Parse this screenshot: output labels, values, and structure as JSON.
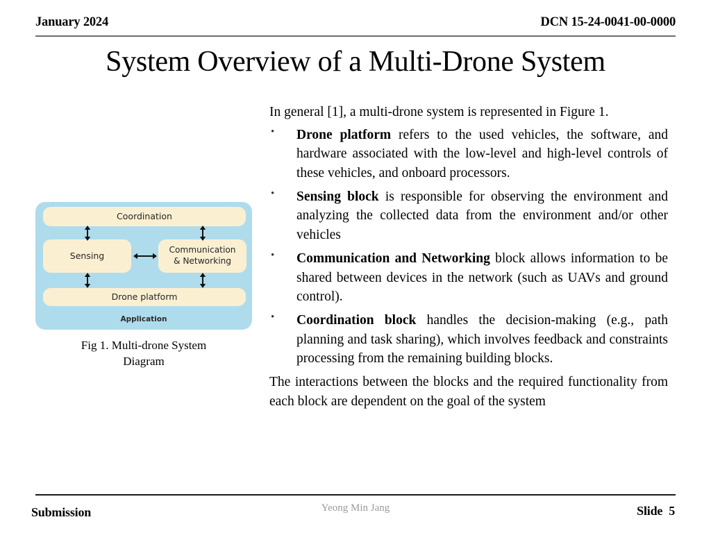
{
  "header": {
    "date": "January 2024",
    "dcn": "DCN 15-24-0041-00-0000"
  },
  "title": "System Overview of a Multi-Drone System",
  "figure": {
    "caption_line1": "Fig 1. Multi-drone System",
    "caption_line2": "Diagram",
    "container_label": "Application",
    "container_color": "#aedcec",
    "block_color": "#fbefd2",
    "blocks": [
      {
        "id": "coordination",
        "label": "Coordination"
      },
      {
        "id": "sensing",
        "label": "Sensing"
      },
      {
        "id": "communication",
        "label_line1": "Communication",
        "label_line2": "& Networking"
      },
      {
        "id": "drone-platform",
        "label": "Drone platform"
      }
    ],
    "arrows": [
      {
        "id": "coordination-sensing",
        "direction": "bidirectional"
      },
      {
        "id": "coordination-communication",
        "direction": "bidirectional"
      },
      {
        "id": "sensing-communication",
        "direction": "bidirectional"
      },
      {
        "id": "sensing-drone-platform",
        "direction": "bidirectional"
      },
      {
        "id": "communication-drone-platform",
        "direction": "bidirectional"
      }
    ]
  },
  "body": {
    "intro": "In general [1], a multi-drone system is represented in Figure 1.",
    "bullets": [
      {
        "term": "Drone platform",
        "text": " refers to the used vehicles, the software, and hardware associated with the low-level and high-level controls of these vehicles, and onboard processors."
      },
      {
        "term": "Sensing block",
        "text": " is responsible for observing the environment and analyzing the collected data from the environment and/or other vehicles"
      },
      {
        "term": "Communication and Networking",
        "text": " block allows information to be shared between devices in the network (such as UAVs and ground control)."
      },
      {
        "term": "Coordination block",
        "text": " handles the decision-making (e.g., path planning and task sharing), which involves feedback and constraints processing from the remaining building blocks."
      }
    ],
    "closing": "The interactions between the blocks and the required functionality from each block are dependent on the goal of the system"
  },
  "footer": {
    "left": "Submission",
    "center": "Yeong Min Jang",
    "slide_label": "Slide",
    "slide_number": "5"
  }
}
